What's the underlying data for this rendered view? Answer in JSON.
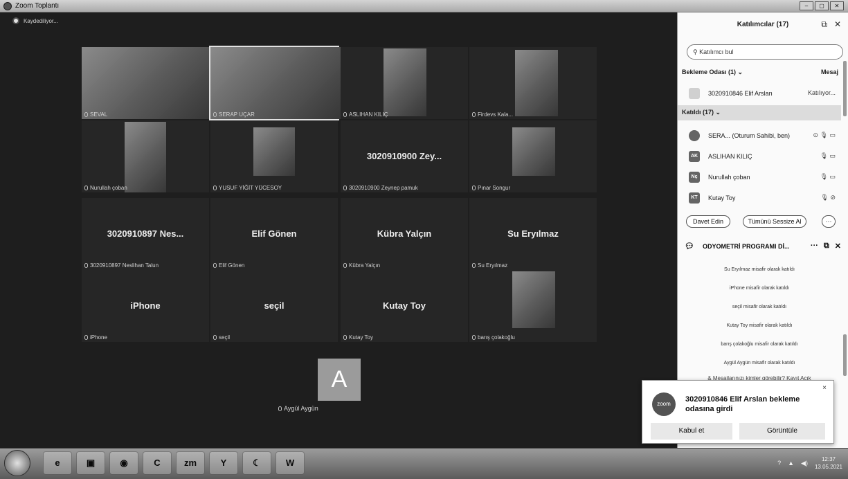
{
  "window": {
    "title": "Zoom Toplantı",
    "min": "–",
    "max": "▢",
    "close": "✕"
  },
  "recording": "Kaydediliyor...",
  "tiles": [
    {
      "name": "SEVAL",
      "has_video": true
    },
    {
      "name": "SERAP UÇAR",
      "has_video": true
    },
    {
      "name": "ASLIHAN KILIÇ",
      "has_video": true
    },
    {
      "name": "Firdevs Kala...",
      "has_video": true
    },
    {
      "name": "Nurullah çoban",
      "has_video": true
    },
    {
      "name": "YUSUF YİĞİT YÜCESOY",
      "has_video": true
    },
    {
      "big": "3020910900 Zey...",
      "name": "3020910900 Zeynep pamuk"
    },
    {
      "name": "Pınar Songur",
      "has_video": true
    },
    {
      "big": "3020910897 Nes...",
      "name": "3020910897 Neslihan Talun"
    },
    {
      "big": "Elif Gönen",
      "name": "Elif Gönen"
    },
    {
      "big": "Kübra Yalçın",
      "name": "Kübra Yalçın"
    },
    {
      "big": "Su Eryılmaz",
      "name": "Su Eryılmaz"
    },
    {
      "big": "iPhone",
      "name": "iPhone"
    },
    {
      "big": "seçil",
      "name": "seçil"
    },
    {
      "big": "Kutay Toy",
      "name": "Kutay Toy"
    },
    {
      "name": "barış çolakoğlu",
      "has_video": true
    }
  ],
  "avatar_letter": "A",
  "avatar_name": "Aygül Aygün",
  "panel": {
    "title": "Katılımcılar (17)",
    "search_placeholder": "Katılımcı bul",
    "waiting_label": "Bekleme Odası (1)",
    "waiting_action": "Mesaj",
    "waiting_name": "3020910846 Elif Arslan",
    "waiting_status": "Katılıyor...",
    "joined_label": "Katıldı (17)",
    "participants": [
      {
        "initials": "",
        "name": "SERA... (Oturum Sahibi, ben)"
      },
      {
        "initials": "AK",
        "name": "ASLIHAN KILIÇ"
      },
      {
        "initials": "Nç",
        "name": "Nurullah çoban"
      },
      {
        "initials": "KT",
        "name": "Kutay Toy"
      }
    ],
    "invite": "Davet Edin",
    "mute_all": "Tümünü Sessize Al",
    "more": "···"
  },
  "chat": {
    "title": "ODYOMETRİ PROGRAMI Dİ...",
    "messages": [
      "Su Eryılmaz misafir olarak katıldı",
      "iPhone misafir olarak katıldı",
      "seçil misafir olarak katıldı",
      "Kutay Toy misafir olarak katıldı",
      "barış çolakoğlu misafir olarak katıldı",
      "Aygül Aygün misafir olarak katıldı"
    ],
    "footer": "Mesajlarınızı kimler görebilir? Kayıt Açık"
  },
  "toast": {
    "logo": "zoom",
    "text": "3020910846 Elif Arslan bekleme odasına girdi",
    "accept": "Kabul et",
    "view": "Görüntüle",
    "close": "×"
  },
  "taskbar": {
    "apps": [
      "e",
      "▣",
      "◉",
      "C",
      "zm",
      "Y",
      "☾",
      "W"
    ],
    "time": "12:37",
    "date": "13.05.2021"
  }
}
